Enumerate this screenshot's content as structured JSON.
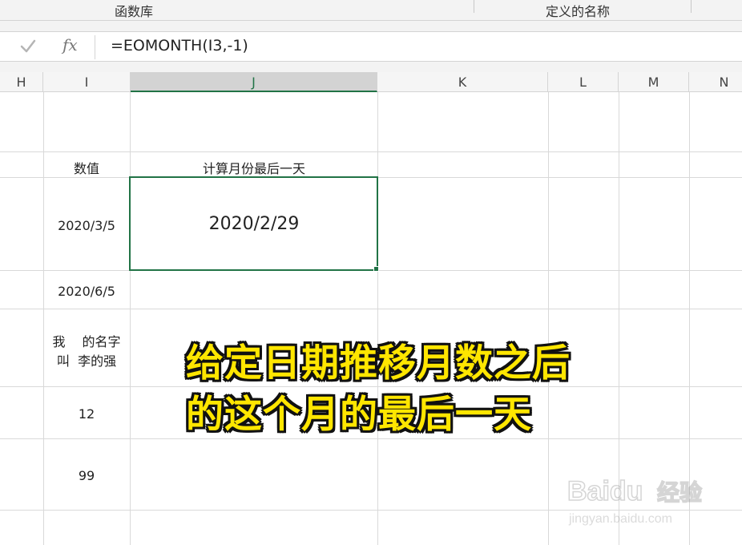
{
  "ribbon": {
    "group_functions": "函数库",
    "group_defined_names": "定义的名称"
  },
  "formula_bar": {
    "check_icon": "check-icon",
    "fx_label": "fx",
    "formula": "=EOMONTH(I3,-1)"
  },
  "columns": {
    "H": "H",
    "I": "I",
    "J": "J",
    "K": "K",
    "L": "L",
    "M": "M",
    "N": "N",
    "selected": "J"
  },
  "cells": {
    "i2": "数值",
    "j2": "计算月份最后一天",
    "i3": "2020/3/5",
    "j3": "2020/2/29",
    "i4": "2020/6/5",
    "i5_line1": "我　 的名字",
    "i5_line2": "叫  李的强",
    "i6": "12",
    "i7": "99"
  },
  "caption": {
    "line1": "给定日期推移月数之后",
    "line2": "的这个月的最后一天",
    "color": "#ffe600"
  },
  "watermark": {
    "brand": "Baidu",
    "product": "经验",
    "url": "jingyan.baidu.com"
  },
  "colors": {
    "accent": "#217346",
    "gridline": "#d9d9d9"
  }
}
